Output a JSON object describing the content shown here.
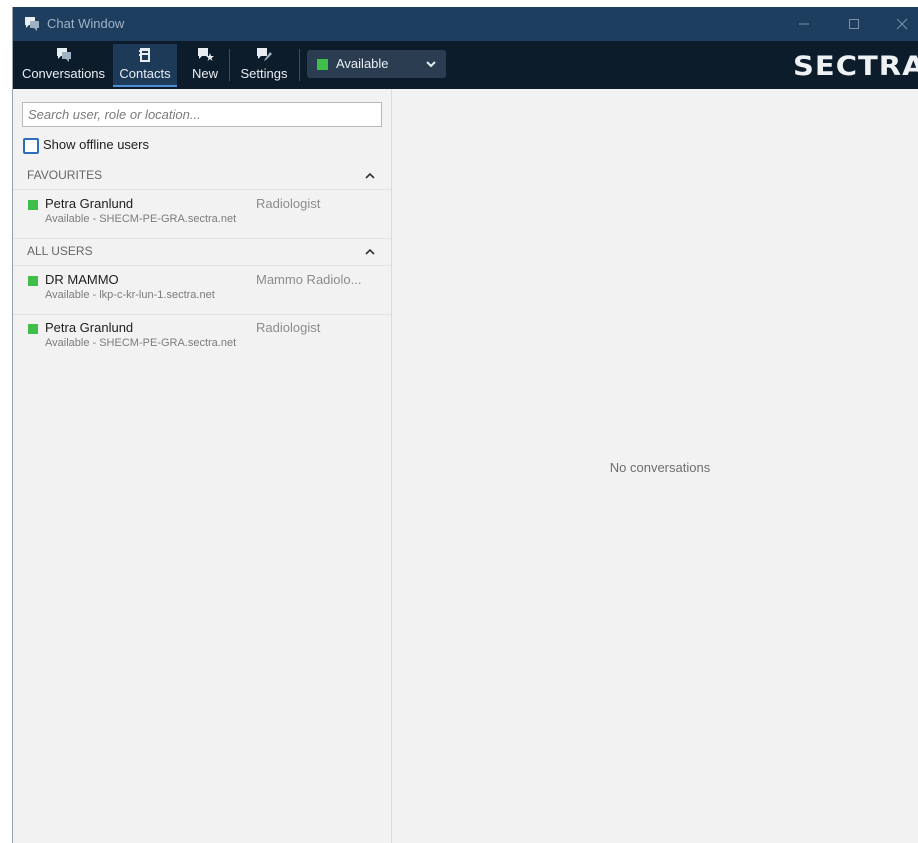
{
  "window": {
    "title": "Chat Window"
  },
  "toolbar": {
    "buttons": [
      {
        "label": "Conversations",
        "icon": "conversations-icon"
      },
      {
        "label": "Contacts",
        "icon": "contacts-icon",
        "active": true
      },
      {
        "label": "New",
        "icon": "new-conversation-icon"
      },
      {
        "label": "Settings",
        "icon": "settings-icon"
      }
    ],
    "status": {
      "label": "Available",
      "color": "#3fbf4a"
    },
    "brand": "SECTRA"
  },
  "contacts": {
    "search_placeholder": "Search user, role or location...",
    "show_offline_label": "Show offline users",
    "show_offline_checked": false,
    "favourites": {
      "header": "FAVOURITES",
      "users": [
        {
          "name": "Petra Granlund",
          "role": "Radiologist",
          "detail": "Available - SHECM-PE-GRA.sectra.net",
          "status_color": "#3fbf4a"
        }
      ]
    },
    "all_users": {
      "header": "ALL USERS",
      "users": [
        {
          "name": "DR MAMMO",
          "role": "Mammo Radiolo...",
          "detail": "Available - lkp-c-kr-lun-1.sectra.net",
          "status_color": "#3fbf4a"
        },
        {
          "name": "Petra Granlund",
          "role": "Radiologist",
          "detail": "Available - SHECM-PE-GRA.sectra.net",
          "status_color": "#3fbf4a"
        }
      ]
    }
  },
  "conversations": {
    "empty_message": "No conversations"
  },
  "colors": {
    "titlebar": "#1d3e5f",
    "toolbar": "#0d1c2b",
    "active_tab_underline": "#4d8fd6",
    "available": "#3fbf4a"
  }
}
